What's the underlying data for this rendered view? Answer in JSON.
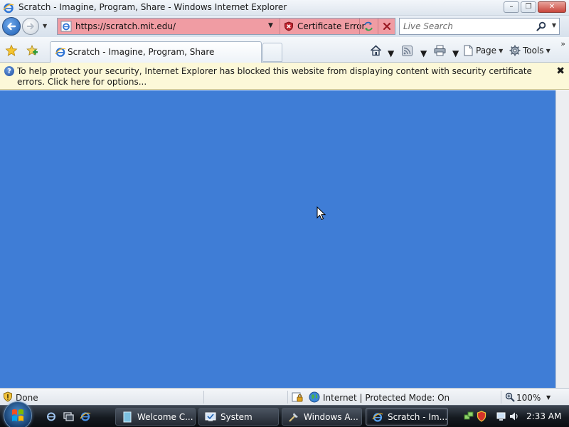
{
  "window": {
    "title": "Scratch - Imagine, Program, Share - Windows Internet Explorer",
    "minimize_glyph": "–",
    "restore_glyph": "❐",
    "close_glyph": "✕"
  },
  "nav": {
    "url": "https://scratch.mit.edu/",
    "certificate_error_label": "Certificate Error",
    "search_placeholder": "Live Search"
  },
  "tabs": [
    {
      "label": "Scratch - Imagine, Program, Share"
    }
  ],
  "commandbar": {
    "page_label": "Page",
    "tools_label": "Tools",
    "overflow_glyph": "»"
  },
  "infobar": {
    "message": "To help protect your security, Internet Explorer has blocked this website from displaying content with security certificate errors. Click here for options...",
    "close_glyph": "✖",
    "info_glyph": "?"
  },
  "content": {
    "background_color": "#3f7dd6"
  },
  "statusbar": {
    "status": "Done",
    "zone": "Internet | Protected Mode: On",
    "zoom": "100%"
  },
  "taskbar": {
    "items": [
      {
        "label": "Welcome C...",
        "icon": "document-icon"
      },
      {
        "label": "System",
        "icon": "system-icon"
      },
      {
        "label": "Windows A...",
        "icon": "tools-icon"
      },
      {
        "label": "Scratch - Im...",
        "icon": "ie-icon",
        "active": true
      }
    ],
    "clock": "2:33 AM"
  },
  "colors": {
    "address_error": "#f09ca3",
    "infobar_bg": "#fcf8d8",
    "page_blue": "#3f7dd6"
  }
}
